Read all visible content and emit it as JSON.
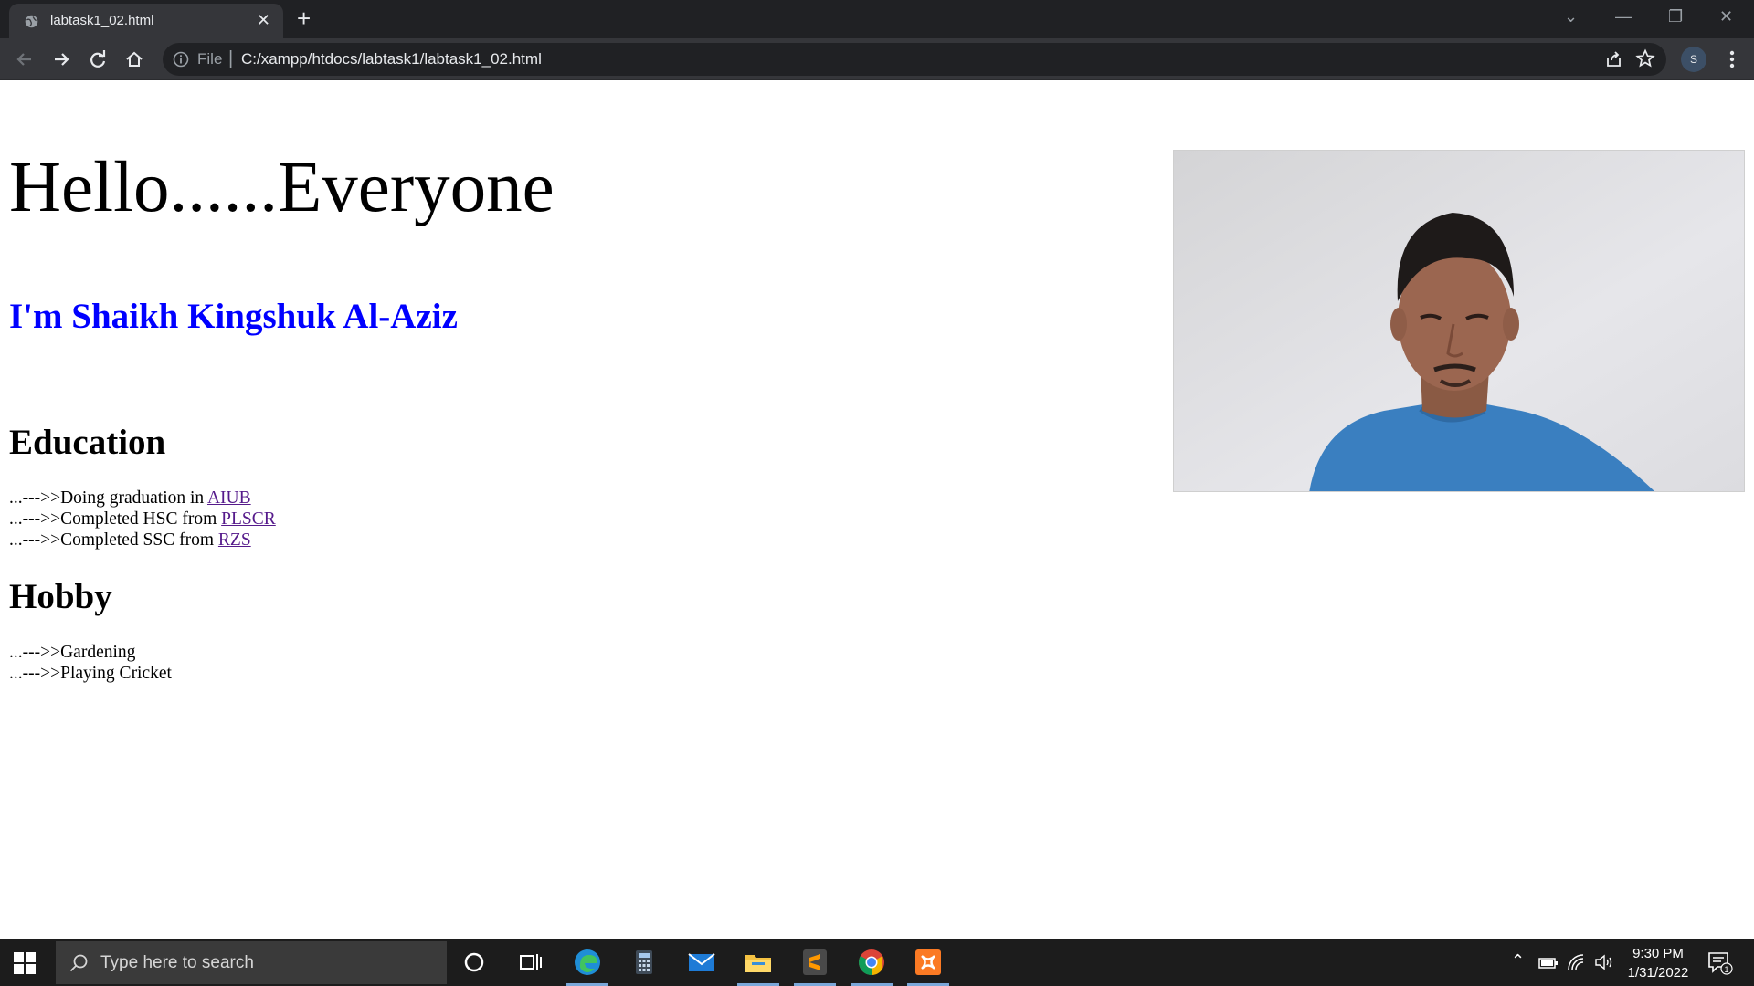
{
  "browser": {
    "tab_title": "labtask1_02.html",
    "scheme_label": "File",
    "url": "C:/xampp/htdocs/labtask1/labtask1_02.html",
    "profile_initial": "S",
    "icons": [
      "back-icon",
      "forward-icon",
      "reload-icon",
      "home-icon",
      "info-icon",
      "share-icon",
      "star-icon",
      "menu-icon"
    ]
  },
  "page": {
    "greeting": "Hello......Everyone",
    "name": "I'm Shaikh Kingshuk Al-Aziz",
    "education": {
      "heading": "Education",
      "items": [
        {
          "prefix": "...--->>Doing graduation in ",
          "link": "AIUB"
        },
        {
          "prefix": "...--->>Completed HSC from ",
          "link": "PLSCR"
        },
        {
          "prefix": "...--->>Completed SSC from ",
          "link": "RZS"
        }
      ]
    },
    "hobby": {
      "heading": "Hobby",
      "items": [
        "...--->>Gardening",
        "...--->>Playing Cricket"
      ]
    }
  },
  "taskbar": {
    "search_placeholder": "Type here to search",
    "time": "9:30 PM",
    "date": "1/31/2022",
    "notification_count": "1"
  },
  "colors": {
    "name_heading": "#0000ff",
    "visited_link": "#551a8b",
    "chrome_dark": "#202124",
    "chrome_toolbar": "#35363a",
    "taskbar": "#1c1c1c"
  }
}
